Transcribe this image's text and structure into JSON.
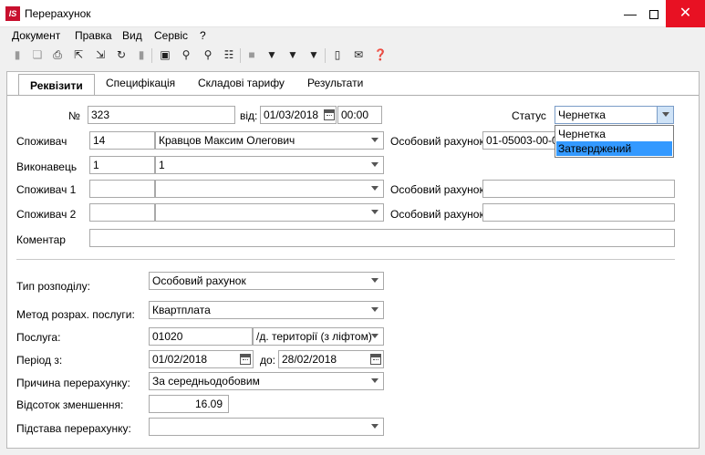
{
  "window": {
    "title": "Перерахунок",
    "logo": "IS"
  },
  "menu": [
    "Документ",
    "Правка",
    "Вид",
    "Сервіс",
    "?"
  ],
  "toolbar": {
    "icons": [
      "add-icon",
      "copy-icon",
      "print-icon",
      "export-icon",
      "import-icon",
      "refresh-icon",
      "delete-icon",
      "save-icon",
      "find-icon",
      "find-next-icon",
      "tree-icon",
      "stop-icon",
      "filter-icon",
      "filter-set-icon",
      "filter-clear-icon",
      "document-icon",
      "mail-icon",
      "help-icon"
    ]
  },
  "tabs": [
    "Реквізити",
    "Специфікація",
    "Складові тарифу",
    "Результати"
  ],
  "form": {
    "number_label": "№",
    "number_value": "323",
    "date_label": "від:",
    "date_value": "01/03/2018",
    "time_value": "00:00",
    "status_label": "Статус",
    "status_value": "Чернетка",
    "status_options": [
      "Чернетка",
      "Затверджений"
    ],
    "consumer_label": "Споживач",
    "consumer_code": "14",
    "consumer_name": "Кравцов Максим Олегович",
    "personal_account_label": "Особовий рахунок",
    "personal_account_value": "01-05003-00-01",
    "executor_label": "Виконавець",
    "executor_code": "1",
    "executor_name": "1",
    "consumer1_label": "Споживач 1",
    "personal_account1_label": "Особовий рахунок",
    "consumer2_label": "Споживач 2",
    "personal_account2_label": "Особовий рахунок",
    "comment_label": "Коментар",
    "distribution_label": "Тип розподілу:",
    "distribution_value": "Особовий рахунок",
    "calc_method_label": "Метод розрах. послуги:",
    "calc_method_value": "Квартплата",
    "service_label": "Послуга:",
    "service_code": "01020",
    "service_name": "/д. території (з ліфтом)",
    "period_label": "Період з:",
    "period_from": "01/02/2018",
    "period_to_label": "до:",
    "period_to": "28/02/2018",
    "reason_label": "Причина перерахунку:",
    "reason_value": "За середньодобовим",
    "reduction_label": "Відсоток зменшення:",
    "reduction_value": "16.09",
    "basis_label": "Підстава перерахунку:",
    "basis_value": ""
  }
}
